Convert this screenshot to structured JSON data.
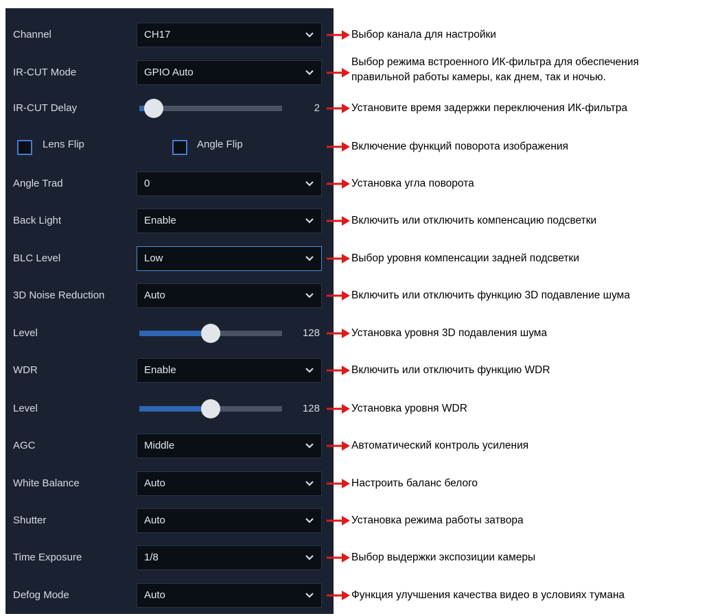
{
  "colors": {
    "panel_bg": "#1a2232",
    "field_bg": "#0a0e15",
    "accent": "#2d66b3",
    "arrow": "#e11919"
  },
  "icons": {
    "dropdown": "chevron-down-icon",
    "annotation": "red-arrow-icon"
  },
  "settings": {
    "channel": {
      "label": "Channel",
      "value": "CH17"
    },
    "ircut_mode": {
      "label": "IR-CUT Mode",
      "value": "GPIO Auto"
    },
    "ircut_delay": {
      "label": "IR-CUT Delay",
      "value": "2",
      "level": 0.1
    },
    "lens_flip": {
      "label": "Lens Flip",
      "checked": false
    },
    "angle_flip": {
      "label": "Angle Flip",
      "checked": false
    },
    "angle_trad": {
      "label": "Angle Trad",
      "value": "0"
    },
    "back_light": {
      "label": "Back Light",
      "value": "Enable"
    },
    "blc_level": {
      "label": "BLC Level",
      "value": "Low"
    },
    "noise_reduction": {
      "label": "3D Noise Reduction",
      "value": "Auto"
    },
    "nr_level": {
      "label": "Level",
      "value": "128",
      "level": 0.5
    },
    "wdr": {
      "label": "WDR",
      "value": "Enable"
    },
    "wdr_level": {
      "label": "Level",
      "value": "128",
      "level": 0.5
    },
    "agc": {
      "label": "AGC",
      "value": "Middle"
    },
    "white_balance": {
      "label": "White Balance",
      "value": "Auto"
    },
    "shutter": {
      "label": "Shutter",
      "value": "Auto"
    },
    "time_exposure": {
      "label": "Time Exposure",
      "value": "1/8"
    },
    "defog_mode": {
      "label": "Defog Mode",
      "value": "Auto"
    }
  },
  "annotations": {
    "channel": "Выбор канала для настройки",
    "ircut_mode_1": "Выбор режима встроенного ИК-фильтра для обеспечения",
    "ircut_mode_2": "правильной работы камеры, как днем, так и ночью.",
    "ircut_delay": "Установите время задержки переключения ИК-фильтра",
    "flip": "Включение функций поворота изображения",
    "angle_trad": "Установка угла поворота",
    "back_light": "Включить или отключить компенсацию подсветки",
    "blc_level": "Выбор уровня компенсации задней подсветки",
    "noise_reduction": "Включить или отключить функцию 3D подавление шума",
    "nr_level": "Установка уровня 3D подавления шума",
    "wdr": "Включить или отключить функцию WDR",
    "wdr_level": "Установка уровня WDR",
    "agc": "Автоматический контроль усиления",
    "white_balance": "Настроить баланс белого",
    "shutter": "Установка режима работы затвора",
    "time_exposure": "Выбор выдержки экспозиции камеры",
    "defog_mode": "Функция улучшения качества видео в условиях тумана"
  }
}
